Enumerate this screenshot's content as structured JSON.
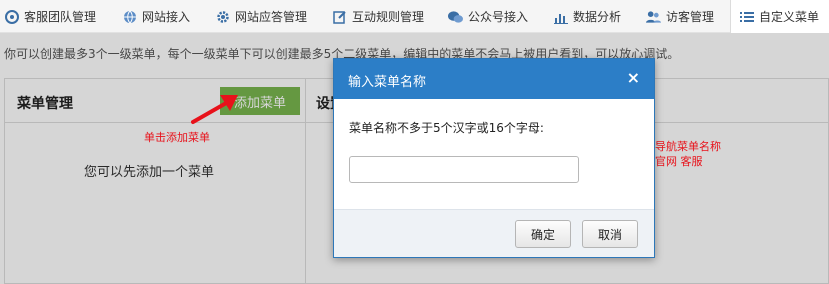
{
  "tabs": [
    {
      "label": "客服团队管理",
      "icon": "team-icon"
    },
    {
      "label": "网站接入",
      "icon": "globe-icon"
    },
    {
      "label": "网站应答管理",
      "icon": "gear-icon"
    },
    {
      "label": "互动规则管理",
      "icon": "edit-icon"
    },
    {
      "label": "公众号接入",
      "icon": "chat-bubbles-icon"
    },
    {
      "label": "数据分析",
      "icon": "bar-chart-icon"
    },
    {
      "label": "访客管理",
      "icon": "users-icon"
    },
    {
      "label": "自定义菜单",
      "icon": "menu-list-icon",
      "active": true
    }
  ],
  "hint_text": "你可以创建最多3个一级菜单，每个一级菜单下可以创建最多5个二级菜单，编辑中的菜单不会马上被用户看到，可以放心调试。",
  "menu_panel": {
    "title": "菜单管理",
    "add_button": "添加菜单",
    "empty_text": "您可以先添加一个菜单"
  },
  "settings_panel": {
    "title": "设置"
  },
  "modal": {
    "title": "输入菜单名称",
    "close": "×",
    "label": "菜单名称不多于5个汉字或16个字母:",
    "input_value": "",
    "input_placeholder": "",
    "ok_button": "确定",
    "cancel_button": "取消"
  },
  "annotations": {
    "add_hint": "单击添加菜单",
    "input_hint_line1": "输入导航菜单名称",
    "input_hint_line2": "例：官网 客服"
  },
  "colors": {
    "accent_blue": "#2c7ec7",
    "add_green": "#79b54e",
    "annotation_red": "#e8121b"
  }
}
